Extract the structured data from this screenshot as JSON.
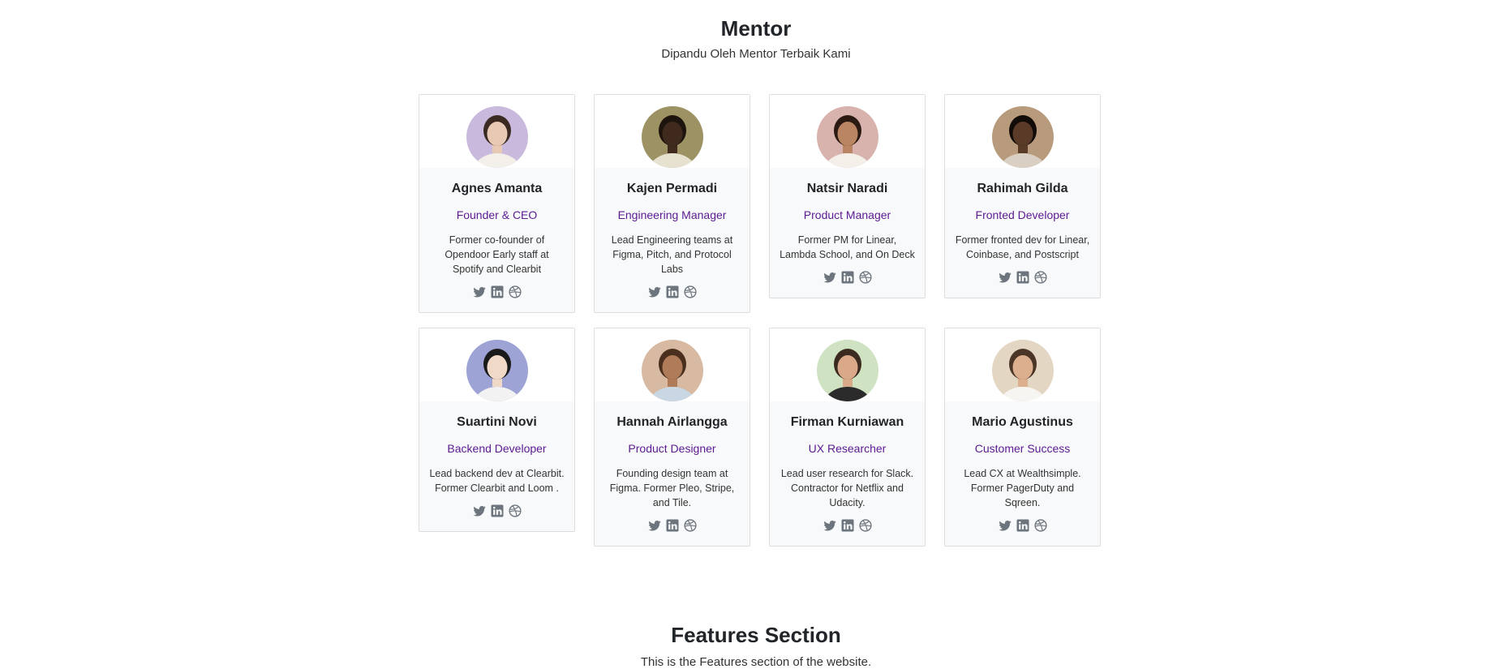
{
  "mentor_section": {
    "title": "Mentor",
    "subtitle": "Dipandu Oleh Mentor Terbaik Kami"
  },
  "mentors": [
    {
      "name": "Agnes Amanta",
      "role": "Founder & CEO",
      "desc": "Former co-founder of Opendoor Early staff at Spotify and Clearbit",
      "avatar_bg": "#c9b9dd",
      "skin": "#e8c9b3",
      "hair": "#3a2a22",
      "shirt": "#f3f0ea"
    },
    {
      "name": "Kajen Permadi",
      "role": "Engineering Manager",
      "desc": "Lead Engineering teams at Figma, Pitch, and Protocol Labs",
      "avatar_bg": "#9c9263",
      "skin": "#3f2a1d",
      "hair": "#1e140e",
      "shirt": "#e7e1cf"
    },
    {
      "name": "Natsir Naradi",
      "role": "Product Manager",
      "desc": "Former PM for Linear, Lambda School, and On Deck",
      "avatar_bg": "#d8b3ad",
      "skin": "#b98563",
      "hair": "#2b1a12",
      "shirt": "#f5efe9"
    },
    {
      "name": "Rahimah Gilda",
      "role": "Fronted Developer",
      "desc": "Former fronted dev for Linear, Coinbase, and Postscript",
      "avatar_bg": "#b89a7c",
      "skin": "#5a3b28",
      "hair": "#120c08",
      "shirt": "#d9cfc3"
    },
    {
      "name": "Suartini Novi",
      "role": "Backend Developer",
      "desc": "Lead backend dev at Clearbit. Former Clearbit and Loom .",
      "avatar_bg": "#9ea3d6",
      "skin": "#f1d9c8",
      "hair": "#1a1a1a",
      "shirt": "#f2f2f2"
    },
    {
      "name": "Hannah Airlangga",
      "role": "Product Designer",
      "desc": "Founding design team at Figma. Former Pleo, Stripe, and Tile.",
      "avatar_bg": "#d8b9a1",
      "skin": "#b07b58",
      "hair": "#4a2e1e",
      "shirt": "#c9d6e3"
    },
    {
      "name": "Firman Kurniawan",
      "role": "UX Researcher",
      "desc": "Lead user research for Slack. Contractor for Netflix and Udacity.",
      "avatar_bg": "#cfe2c2",
      "skin": "#d9a98a",
      "hair": "#3b2a20",
      "shirt": "#2b2b2b"
    },
    {
      "name": "Mario Agustinus",
      "role": "Customer Success",
      "desc": "Lead CX at Wealthsimple. Former PagerDuty and Sqreen.",
      "avatar_bg": "#e3d7c4",
      "skin": "#dcb08e",
      "hair": "#4b3526",
      "shirt": "#f7f5f2"
    }
  ],
  "social_icons": [
    "twitter-icon",
    "linkedin-icon",
    "dribbble-icon"
  ],
  "icon_color": "#6c757d",
  "accent_color": "#5b1a91",
  "features_section": {
    "title": "Features Section",
    "subtitle": "This is the Features section of the website."
  }
}
